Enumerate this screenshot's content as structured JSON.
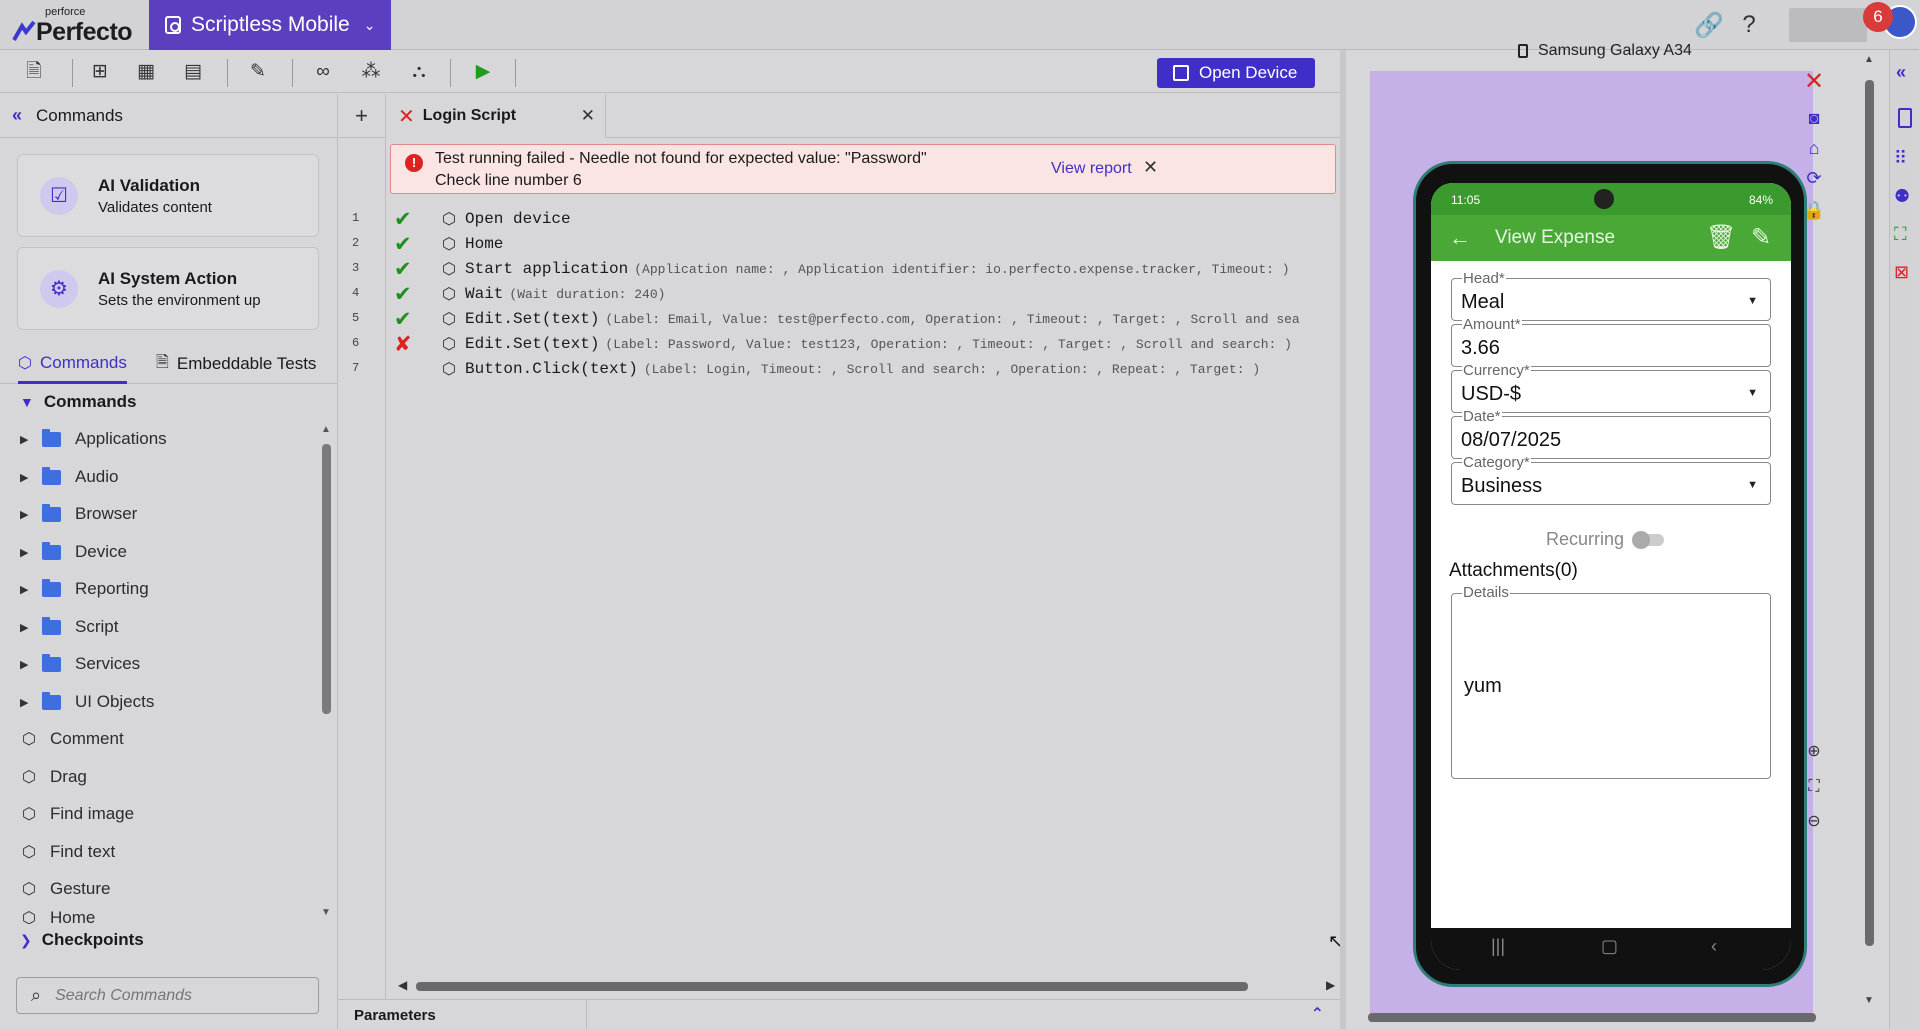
{
  "header": {
    "brand_small": "perforce",
    "brand": "Perfecto",
    "app_name": "Scriptless Mobile",
    "notification_count": "6"
  },
  "toolbar": {
    "open_device_label": "Open Device"
  },
  "left_panel": {
    "title": "Commands",
    "ai_cards": [
      {
        "title": "AI Validation",
        "subtitle": "Validates content"
      },
      {
        "title": "AI System Action",
        "subtitle": "Sets the environment up"
      }
    ],
    "tabs": [
      "Commands",
      "Embeddable Tests"
    ],
    "tree_title": "Commands",
    "folders": [
      "Applications",
      "Audio",
      "Browser",
      "Device",
      "Reporting",
      "Script",
      "Services",
      "UI Objects"
    ],
    "commands": [
      "Comment",
      "Drag",
      "Find image",
      "Find text",
      "Gesture",
      "Home"
    ],
    "checkpoints_label": "Checkpoints",
    "search_placeholder": "Search Commands"
  },
  "editor": {
    "tab_title": "Login Script",
    "alert": {
      "line1": "Test running failed - Needle not found for expected value: \"Password\"",
      "line2": "Check line number 6",
      "link": "View report"
    },
    "lines": [
      {
        "num": "1",
        "status": "ok",
        "cmd": "Open device",
        "params": ""
      },
      {
        "num": "2",
        "status": "ok",
        "cmd": "Home",
        "params": ""
      },
      {
        "num": "3",
        "status": "ok",
        "cmd": "Start application",
        "params": "(Application name: , Application identifier: io.perfecto.expense.tracker, Timeout: )"
      },
      {
        "num": "4",
        "status": "ok",
        "cmd": "Wait",
        "params": "(Wait duration: 240)"
      },
      {
        "num": "5",
        "status": "ok",
        "cmd": "Edit.Set(text)",
        "params": "(Label: Email, Value: test@perfecto.com, Operation: , Timeout: , Target: , Scroll and sea"
      },
      {
        "num": "6",
        "status": "fail",
        "cmd": "Edit.Set(text)",
        "params": "(Label: Password, Value: test123, Operation: , Timeout: , Target: , Scroll and search: )"
      },
      {
        "num": "7",
        "status": "none",
        "cmd": "Button.Click(text)",
        "params": "(Label: Login, Timeout: , Scroll and search: , Operation: , Repeat: , Target: )"
      }
    ],
    "params_label": "Parameters"
  },
  "device": {
    "name": "Samsung Galaxy A34",
    "status_time": "11:05",
    "status_battery": "84%",
    "screen_title": "View Expense",
    "fields": [
      {
        "label": "Head*",
        "value": "Meal",
        "dropdown": true
      },
      {
        "label": "Amount*",
        "value": "3.66",
        "dropdown": false
      },
      {
        "label": "Currency*",
        "value": "USD-$",
        "dropdown": true
      },
      {
        "label": "Date*",
        "value": "08/07/2025",
        "dropdown": false
      },
      {
        "label": "Category*",
        "value": "Business",
        "dropdown": true
      }
    ],
    "recurring_label": "Recurring",
    "attachments_label": "Attachments(0)",
    "details_label": "Details",
    "details_value": "yum"
  },
  "colors": {
    "accent": "#3f2fc8",
    "app_switch": "#5b3fbf",
    "ok": "#1f8f1f",
    "fail": "#dd2222",
    "phone_appbar": "#4aa837"
  }
}
